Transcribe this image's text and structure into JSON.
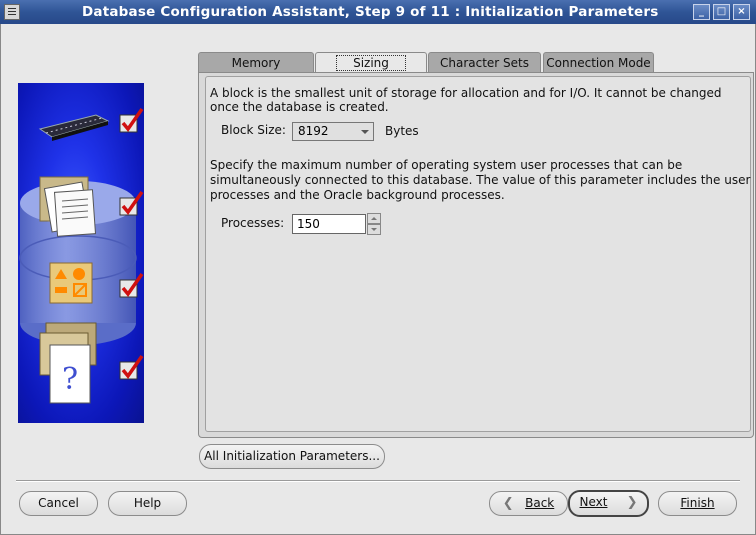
{
  "window": {
    "title": "Database Configuration Assistant, Step 9 of 11 : Initialization Parameters",
    "controls": [
      "_",
      "□",
      "×"
    ]
  },
  "tabs": [
    {
      "label": "Memory",
      "active": false
    },
    {
      "label": "Sizing",
      "active": true
    },
    {
      "label": "Character Sets",
      "active": false
    },
    {
      "label": "Connection Mode",
      "active": false
    }
  ],
  "sizing": {
    "block_desc_1": "A block is the smallest unit of storage for allocation and for I/O. It cannot be changed",
    "block_desc_2": "once the database is created.",
    "block_size_label": "Block Size:",
    "block_size_value": "8192",
    "block_size_unit": "Bytes",
    "process_desc_1": "Specify the maximum number of operating system user processes that can be",
    "process_desc_2": "simultaneously connected to this database. The value of this parameter includes the user",
    "process_desc_3": "processes and the Oracle background processes.",
    "processes_label": "Processes:",
    "processes_value": "150"
  },
  "buttons": {
    "all_params": "All Initialization Parameters...",
    "cancel": "Cancel",
    "help": "Help",
    "back": "Back",
    "next": "Next",
    "finish": "Finish"
  },
  "sidebar": {
    "steps": [
      {
        "icon": "memory-chip-icon",
        "checked": true
      },
      {
        "icon": "documents-folder-icon",
        "checked": true
      },
      {
        "icon": "shapes-icon",
        "checked": true
      },
      {
        "icon": "help-document-icon",
        "checked": true
      }
    ]
  },
  "colors": {
    "titlebar": "#2f5596",
    "sidebar": "#1f32e8",
    "check": "#d01010"
  }
}
